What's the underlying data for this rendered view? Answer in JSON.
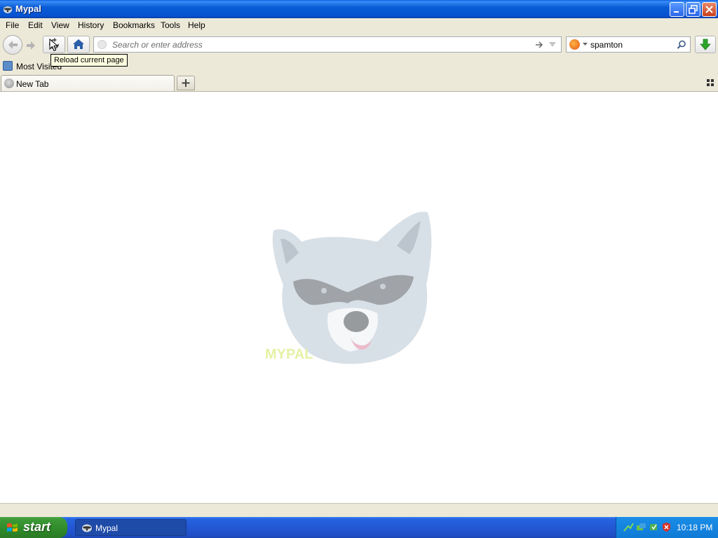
{
  "window": {
    "title": "Mypal"
  },
  "menu": {
    "items": [
      "File",
      "Edit",
      "View",
      "History",
      "Bookmarks",
      "Tools",
      "Help"
    ]
  },
  "toolbar": {
    "address_placeholder": "Search or enter address",
    "address_value": "",
    "search_value": "spamton",
    "reload_tooltip": "Reload current page"
  },
  "bookmarks": {
    "items": [
      {
        "label": "Most Visited"
      }
    ]
  },
  "tabs": {
    "items": [
      {
        "label": "New Tab",
        "icon": "globe-icon"
      }
    ]
  },
  "content": {
    "logo": "raccoon-logo",
    "logo_text": "MYPAL"
  },
  "taskbar": {
    "start_label": "start",
    "task_label": "Mypal",
    "clock": "10:18 PM",
    "tray_icons": [
      "network-icon",
      "network-icon-2",
      "update-icon",
      "security-shield-icon"
    ]
  },
  "colors": {
    "title_bar": "#0a5cd6",
    "chrome": "#ece9d8",
    "taskbar": "#2458d4",
    "start_button": "#3c9a36",
    "tooltip_bg": "#ffffe1"
  }
}
